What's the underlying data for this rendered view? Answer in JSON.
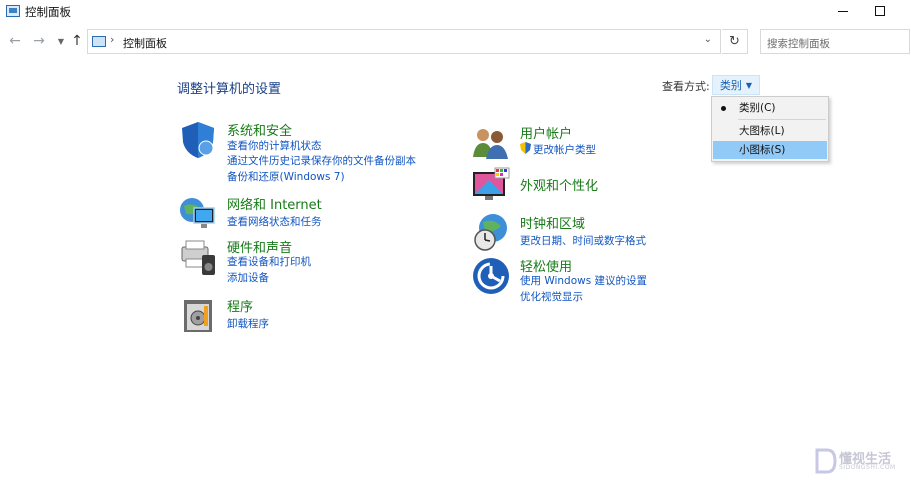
{
  "window": {
    "title": "控制面板"
  },
  "address": {
    "path": "控制面板",
    "separator": "›"
  },
  "search": {
    "placeholder": "搜索控制面板"
  },
  "main": {
    "heading": "调整计算机的设置",
    "view_by_label": "查看方式:",
    "view_by_value": "类别"
  },
  "view_menu": {
    "items": [
      {
        "label": "类别(C)",
        "selected": true
      },
      {
        "label": "大图标(L)",
        "selected": false
      },
      {
        "label": "小图标(S)",
        "selected": false,
        "highlighted": true
      }
    ]
  },
  "categories_left": [
    {
      "title": "系统和安全",
      "icon": "shield-icon",
      "links": [
        "查看你的计算机状态",
        "通过文件历史记录保存你的文件备份副本",
        "备份和还原(Windows 7)"
      ]
    },
    {
      "title": "网络和 Internet",
      "icon": "network-globe-icon",
      "links": [
        "查看网络状态和任务"
      ]
    },
    {
      "title": "硬件和声音",
      "icon": "printer-speaker-icon",
      "links": [
        "查看设备和打印机",
        "添加设备"
      ]
    },
    {
      "title": "程序",
      "icon": "programs-box-icon",
      "links": [
        "卸载程序"
      ]
    }
  ],
  "categories_right": [
    {
      "title": "用户帐户",
      "icon": "users-icon",
      "links": [
        "更改帐户类型"
      ]
    },
    {
      "title": "外观和个性化",
      "icon": "monitor-palette-icon",
      "links": []
    },
    {
      "title": "时钟和区域",
      "icon": "clock-globe-icon",
      "links": [
        "更改日期、时间或数字格式"
      ]
    },
    {
      "title": "轻松使用",
      "icon": "ease-of-access-icon",
      "links": [
        "使用 Windows 建议的设置",
        "优化视觉显示"
      ]
    }
  ],
  "watermark": {
    "text": "懂视生活",
    "sub": "SIDONGSHI.COM"
  }
}
